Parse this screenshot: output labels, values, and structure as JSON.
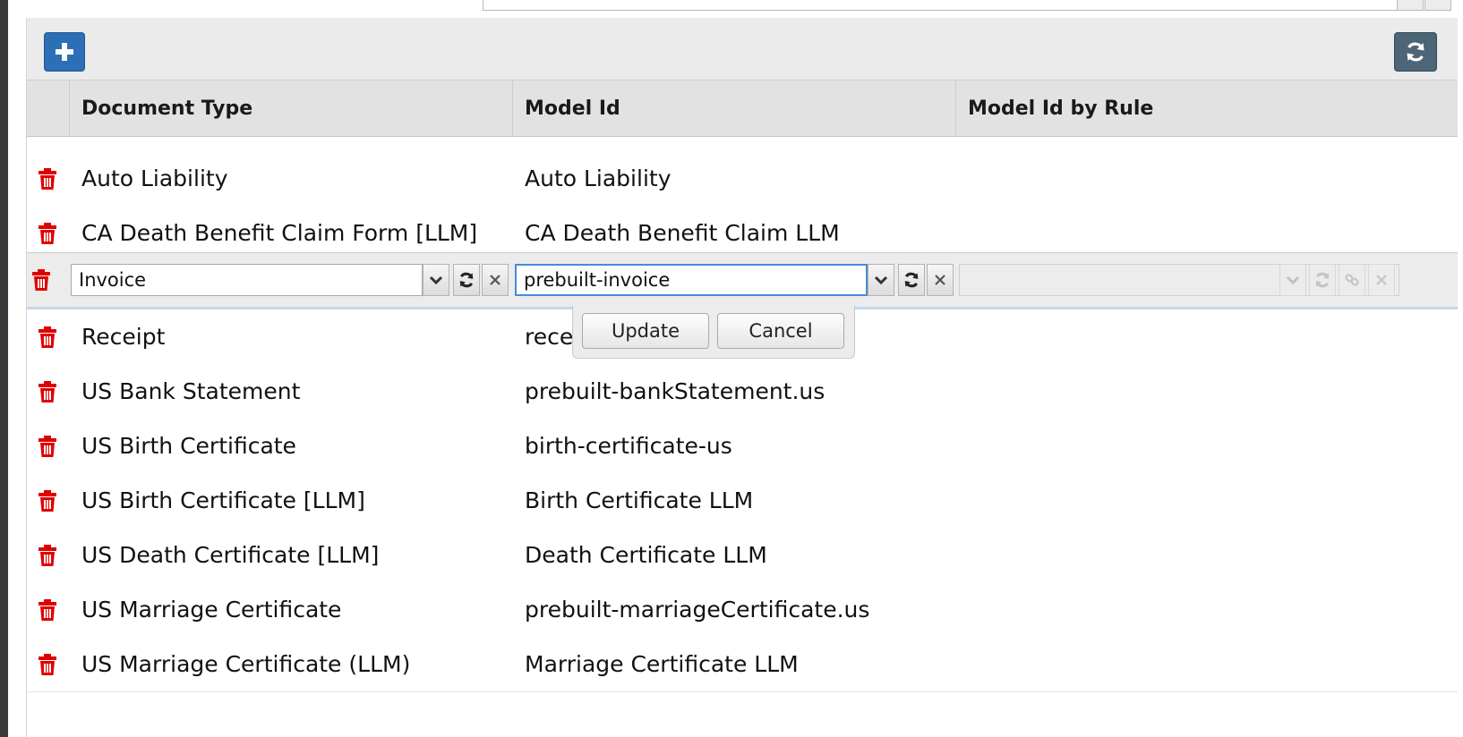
{
  "toolbar": {
    "add_icon": "plus-icon",
    "refresh_icon": "refresh-icon"
  },
  "columns": [
    "Document Type",
    "Model Id",
    "Model Id by Rule"
  ],
  "rows_above": [
    {
      "document_type": "Auto Liability",
      "model_id": "Auto Liability"
    },
    {
      "document_type": "CA Death Benefit Claim Form [LLM]",
      "model_id": "CA Death Benefit Claim LLM"
    }
  ],
  "edit_row": {
    "document_type_value": "Invoice",
    "model_id_value": "prebuilt-invoice",
    "model_id_by_rule_value": ""
  },
  "popup": {
    "update_label": "Update",
    "cancel_label": "Cancel"
  },
  "rows_below": [
    {
      "document_type": "Receipt",
      "model_id": "recei"
    },
    {
      "document_type": "US Bank Statement",
      "model_id": "prebuilt-bankStatement.us"
    },
    {
      "document_type": "US Birth Certificate",
      "model_id": "birth-certificate-us"
    },
    {
      "document_type": "US Birth Certificate [LLM]",
      "model_id": "Birth Certificate LLM"
    },
    {
      "document_type": "US Death Certificate [LLM]",
      "model_id": "Death Certificate LLM"
    },
    {
      "document_type": "US Marriage Certificate",
      "model_id": "prebuilt-marriageCertificate.us"
    },
    {
      "document_type": "US Marriage Certificate (LLM)",
      "model_id": "Marriage Certificate LLM"
    }
  ],
  "colors": {
    "add_button": "#2c6fb6",
    "refresh_button": "#4d6677",
    "delete_icon": "#e00000",
    "header_bg": "#e2e2e2"
  }
}
